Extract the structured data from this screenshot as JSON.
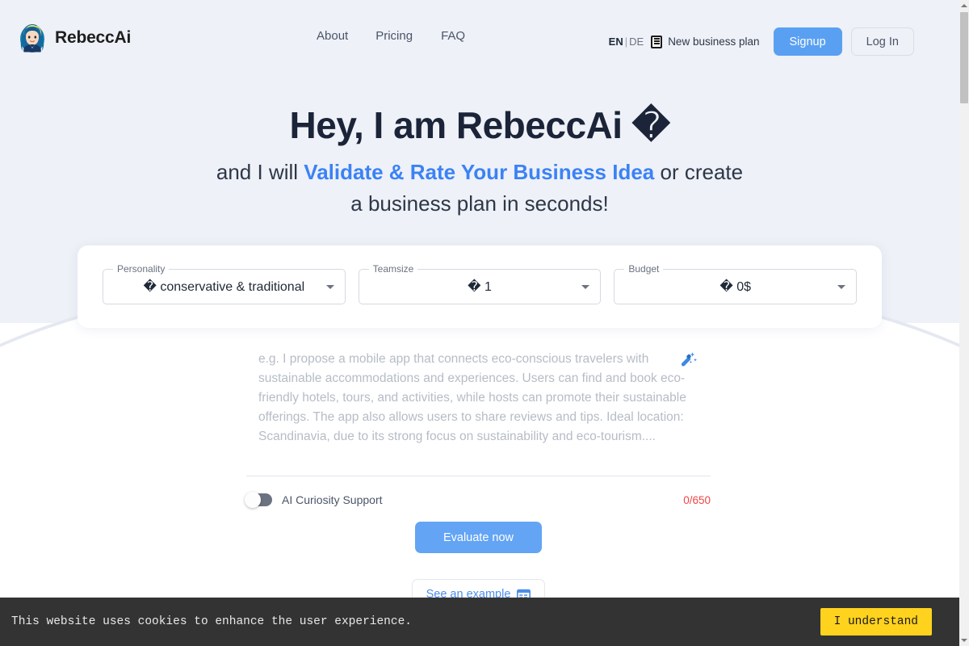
{
  "header": {
    "brand": {
      "name": "RebeccAi",
      "avatar_icon": "rebecca-avatar-icon"
    },
    "nav": [
      {
        "label": "About"
      },
      {
        "label": "Pricing"
      },
      {
        "label": "FAQ"
      }
    ],
    "language": {
      "active": "EN",
      "separator": "|",
      "inactive": "DE"
    },
    "business_plan": {
      "label": "New business plan",
      "icon": "document-icon"
    },
    "signup_label": "Signup",
    "login_label": "Log In"
  },
  "hero": {
    "headline": "Hey, I am RebeccAi �",
    "sub_line1_prefix": "and I will ",
    "sub_line1_accent": "Validate & Rate Your Business Idea",
    "sub_line1_suffix": " or create",
    "sub_line2": "a business plan in seconds!"
  },
  "selectors": [
    {
      "label": "Personality",
      "value": "� conservative & traditional"
    },
    {
      "label": "Teamsize",
      "value": "� 1"
    },
    {
      "label": "Budget",
      "value": "� 0$"
    }
  ],
  "idea": {
    "placeholder": "e.g. I propose a mobile app that connects eco-conscious travelers with sustainable accommodations and experiences. Users can find and book eco-friendly hotels, tours, and activities, while hosts can promote their sustainable offerings. The app also allows users to share reviews and tips. Ideal location: Scandinavia, due to its strong focus on sustainability and eco-tourism....",
    "value": "",
    "magic_icon": "magic-wand-icon",
    "toggle_label": "AI Curiosity Support",
    "toggle_state": "off",
    "char_count": "0/650",
    "char_count_color": "#ef4444"
  },
  "actions": {
    "evaluate_label": "Evaluate now",
    "example_label": "See an example",
    "example_icon": "calendar-icon"
  },
  "cookie": {
    "message": "This website uses cookies to enhance the user experience.",
    "accept_label": "I understand"
  },
  "colors": {
    "accent_blue": "#3b82f6",
    "button_blue": "#5aa0f2",
    "hero_bg": "#eef1f7",
    "cookie_bg": "#333333",
    "cookie_btn": "#ffd21e"
  }
}
